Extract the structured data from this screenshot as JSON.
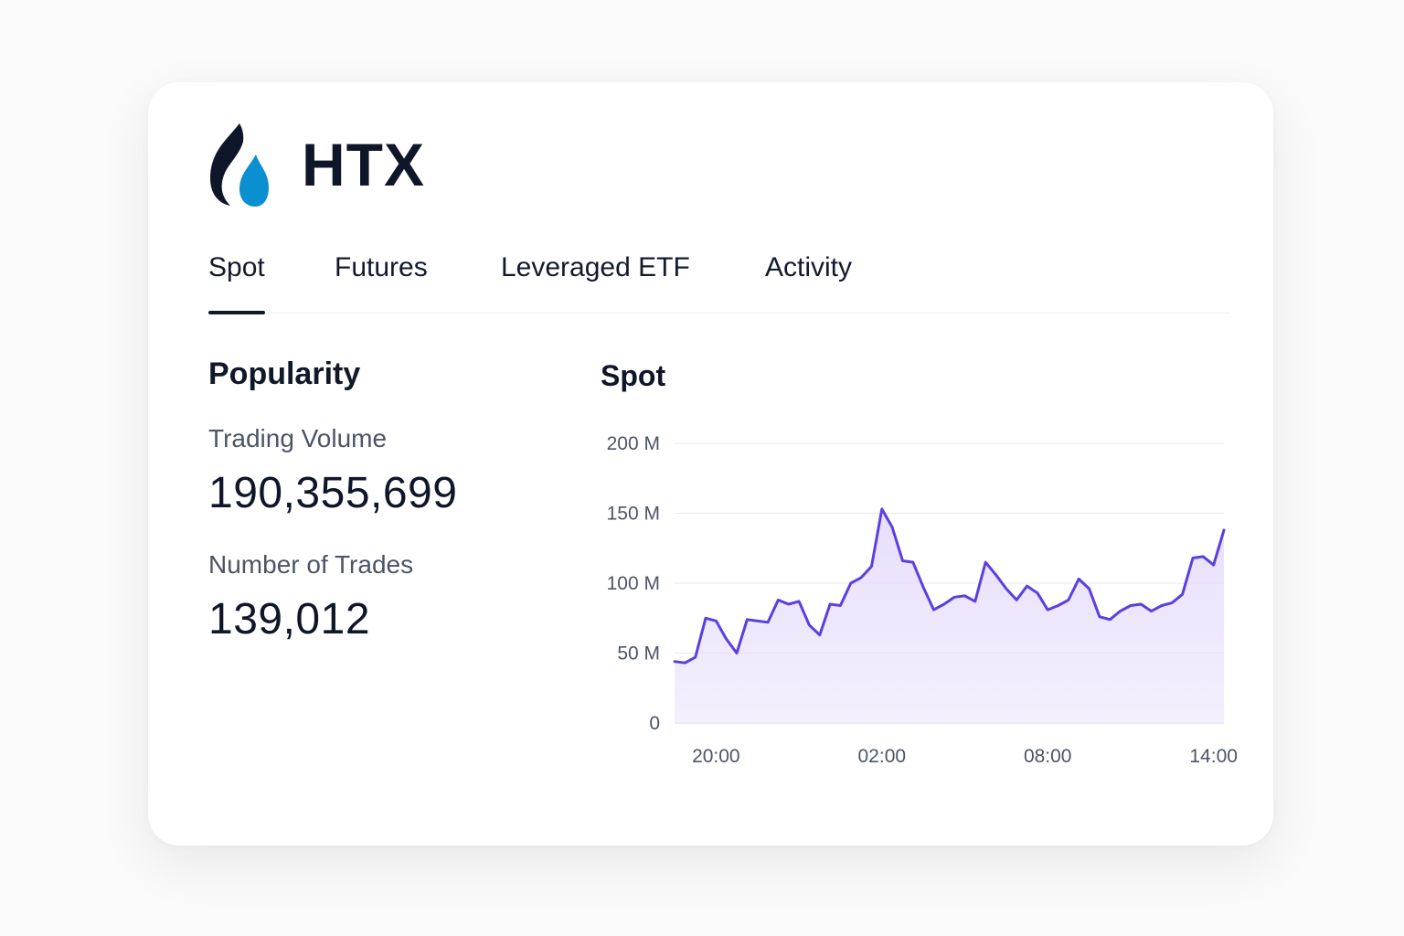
{
  "brand": {
    "name": "HTX",
    "logo_icon": "htx-flame-icon",
    "colors": {
      "dark": "#0f1629",
      "accent": "#0a8fd1"
    }
  },
  "tabs": [
    {
      "label": "Spot",
      "active": true
    },
    {
      "label": "Futures",
      "active": false
    },
    {
      "label": "Leveraged ETF",
      "active": false
    },
    {
      "label": "Activity",
      "active": false
    }
  ],
  "popularity": {
    "title": "Popularity",
    "trading_volume_label": "Trading Volume",
    "trading_volume_value": "190,355,699",
    "trades_label": "Number of Trades",
    "trades_value": "139,012"
  },
  "chart_data": {
    "type": "area",
    "title": "Spot",
    "xlabel": "",
    "ylabel": "",
    "ylim": [
      0,
      200
    ],
    "yticks": [
      "0",
      "50 M",
      "100 M",
      "150 M",
      "200 M"
    ],
    "ytick_values": [
      0,
      50,
      100,
      150,
      200
    ],
    "xticks": [
      "20:00",
      "02:00",
      "08:00",
      "14:00"
    ],
    "xtick_positions": [
      4,
      20,
      36,
      52
    ],
    "grid": true,
    "line_color": "#5b3fe0",
    "fill_color": "#e6ddfb",
    "series": [
      {
        "values": [
          44,
          43,
          47,
          75,
          73,
          60,
          50,
          74,
          73,
          72,
          88,
          85,
          87,
          70,
          63,
          85,
          84,
          100,
          104,
          112,
          153,
          140,
          116,
          115,
          97,
          81,
          85,
          90,
          91,
          87,
          115,
          106,
          96,
          88,
          98,
          93,
          81,
          84,
          88,
          103,
          96,
          76,
          74,
          80,
          84,
          85,
          80,
          84,
          86,
          92,
          118,
          119,
          113,
          138
        ]
      }
    ]
  }
}
